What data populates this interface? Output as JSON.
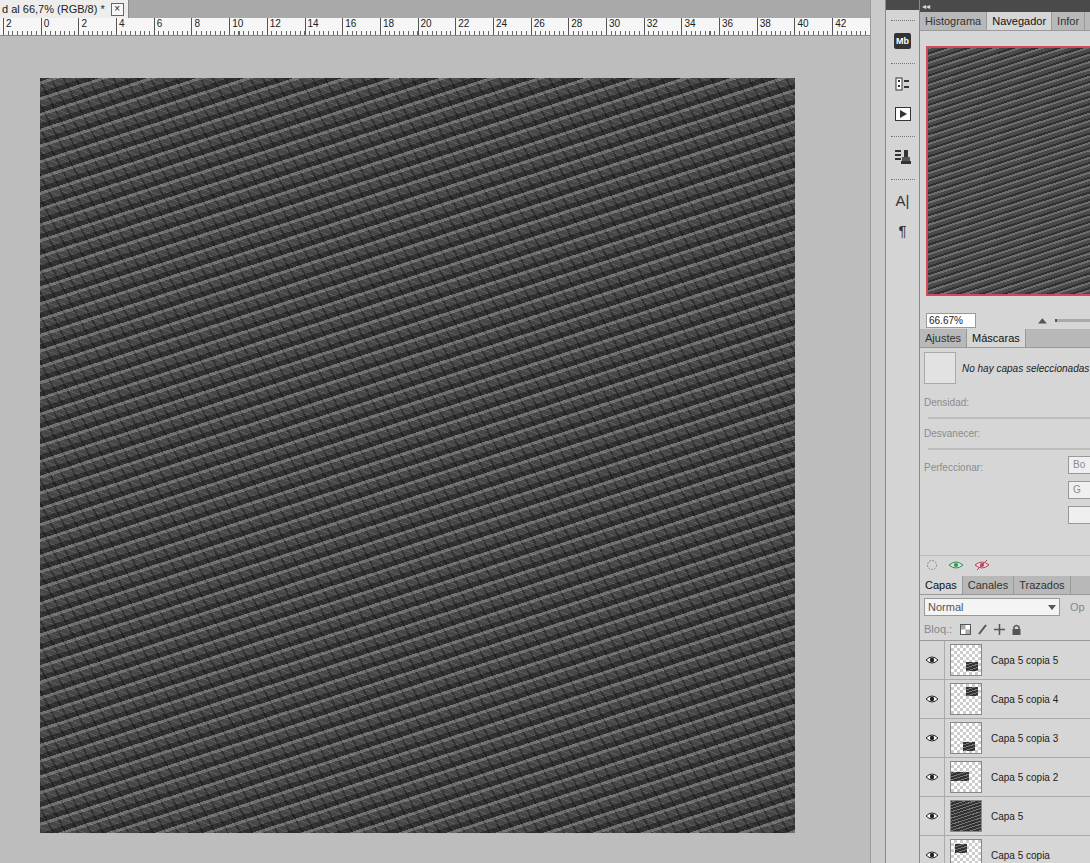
{
  "document_tab": {
    "title": "d al 66,7% (RGB/8) *",
    "close": "×"
  },
  "ruler": {
    "labels": [
      "2",
      "0",
      "2",
      "4",
      "6",
      "8",
      "10",
      "12",
      "14",
      "16",
      "18",
      "20",
      "22",
      "24",
      "26",
      "28",
      "30",
      "32",
      "34",
      "36",
      "38",
      "40",
      "42"
    ]
  },
  "dock": {
    "collapse": "◂◂",
    "groups": [
      [
        {
          "kind": "badge",
          "label": "Mb"
        }
      ],
      [
        {
          "kind": "history"
        },
        {
          "kind": "actions"
        }
      ],
      [
        {
          "kind": "presets"
        }
      ],
      [
        {
          "kind": "glyph",
          "label": "A|"
        },
        {
          "kind": "glyph",
          "label": "¶"
        }
      ]
    ]
  },
  "navigator": {
    "tabs": [
      {
        "label": "Histograma",
        "selected": false
      },
      {
        "label": "Navegador",
        "selected": true
      },
      {
        "label": "Infor",
        "selected": false
      }
    ],
    "zoom": "66.67%",
    "zoom_level": 0.05
  },
  "masks": {
    "tabs": [
      {
        "label": "Ajustes",
        "selected": false
      },
      {
        "label": "Máscaras",
        "selected": true
      }
    ],
    "message": "No hay capas seleccionadas",
    "sliders": [
      {
        "label": "Densidad:",
        "disabled": true
      },
      {
        "label": "Desvanecer:",
        "disabled": true
      }
    ],
    "refine": {
      "label": "Perfeccionar:",
      "disabled": true,
      "buttons": [
        "Bo",
        "G",
        ""
      ]
    }
  },
  "layers": {
    "tabs": [
      {
        "label": "Capas",
        "selected": true
      },
      {
        "label": "Canales",
        "selected": false
      },
      {
        "label": "Trazados",
        "selected": false
      }
    ],
    "blend_mode": "Normal",
    "opacity_label": "Op",
    "lock_label": "Bloq.:",
    "items": [
      {
        "name": "Capa 5 copia 5",
        "visible": true,
        "selected": false
      },
      {
        "name": "Capa 5 copia 4",
        "visible": true,
        "selected": false
      },
      {
        "name": "Capa 5 copia 3",
        "visible": true,
        "selected": false
      },
      {
        "name": "Capa 5 copia 2",
        "visible": true,
        "selected": false
      },
      {
        "name": "Capa 5",
        "visible": true,
        "selected": false
      },
      {
        "name": "Capa 5 copia",
        "visible": true,
        "selected": false
      }
    ]
  }
}
